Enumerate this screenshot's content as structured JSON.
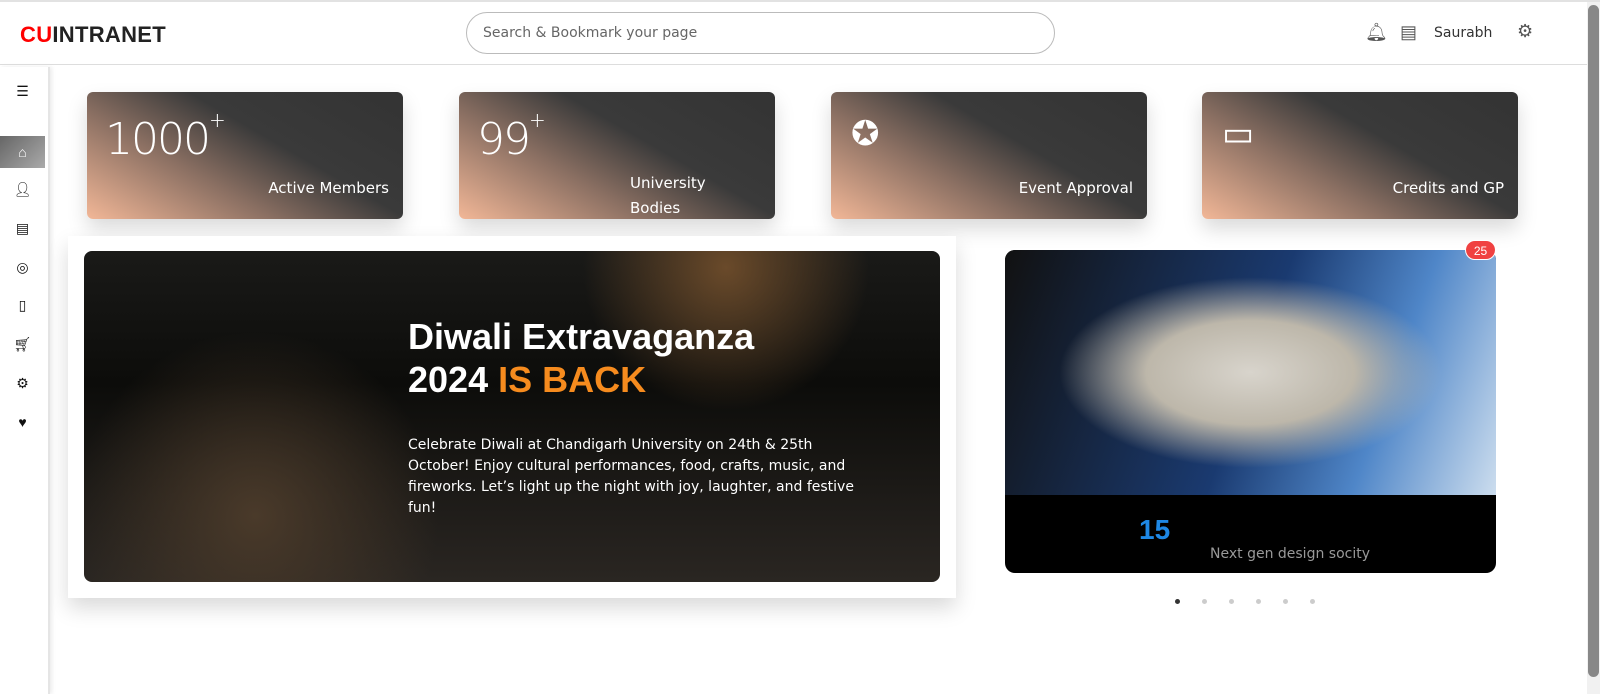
{
  "header": {
    "logo_cu": "CU",
    "logo_rest": "INTRANET",
    "search_placeholder": "Search & Bookmark your page",
    "user": "Saurabh"
  },
  "sidebar": {
    "items": [
      "home",
      "user",
      "chat",
      "activity",
      "document",
      "cart",
      "settings",
      "favorites"
    ]
  },
  "stats": [
    {
      "value": "1000",
      "sup": "+",
      "label": "Active Members"
    },
    {
      "value": "99",
      "sup": "+",
      "label": "University Bodies"
    },
    {
      "icon": "badge-check-icon",
      "label": "Event Approval"
    },
    {
      "icon": "credit-card-check-icon",
      "label": "Credits and GP"
    }
  ],
  "banner": {
    "title_line1": "Diwali Extravaganza",
    "title_year": "2024",
    "title_highlight": "IS BACK",
    "description": "Celebrate Diwali at Chandigarh University on 24th & 25th October! Enjoy cultural performances, food, crafts, music, and fireworks. Let’s light up the night with joy, laughter, and festive fun!"
  },
  "carousel": {
    "badge": "25",
    "number": "15",
    "label": "Next gen design socity",
    "slides": 6,
    "active_slide": 1
  }
}
